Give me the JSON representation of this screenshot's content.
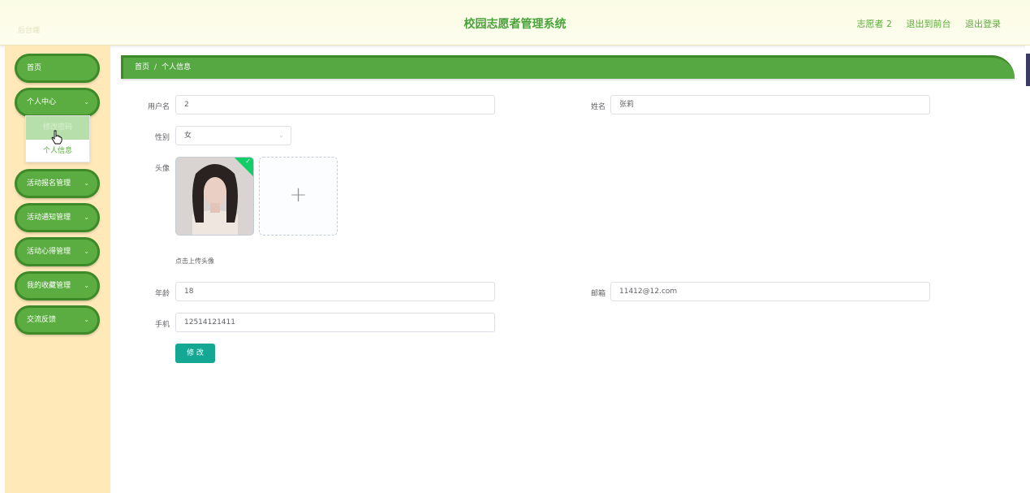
{
  "header": {
    "faint_text": "后台端",
    "title": "校园志愿者管理系统",
    "user": "志愿者 2",
    "to_front": "退出到前台",
    "logout": "退出登录"
  },
  "sidebar": {
    "items": [
      {
        "label": "首页"
      },
      {
        "label": "个人中心"
      },
      {
        "label": "活动报名管理"
      },
      {
        "label": "活动通知管理"
      },
      {
        "label": "活动心得管理"
      },
      {
        "label": "我的收藏管理"
      },
      {
        "label": "交流反馈"
      }
    ],
    "submenu": [
      {
        "label": "修改密码"
      },
      {
        "label": "个人信息"
      }
    ]
  },
  "breadcrumb": {
    "home": "首页",
    "separator": "/",
    "current": "个人信息"
  },
  "form": {
    "username_label": "用户名",
    "username_value": "2",
    "name_label": "姓名",
    "name_value": "张莉",
    "gender_label": "性别",
    "gender_value": "女",
    "avatar_label": "头像",
    "avatar_hint": "点击上传头像",
    "age_label": "年龄",
    "age_value": "18",
    "email_label": "邮箱",
    "email_value": "11412@12.com",
    "phone_label": "手机",
    "phone_value": "12514121411",
    "submit_label": "修 改"
  },
  "icons": {
    "chevron": "chevron-down-icon",
    "upload": "plus-icon",
    "success": "check-icon"
  },
  "colors": {
    "accent_green": "#5cad41",
    "sidebar_bg": "#ffe9b9",
    "submit_teal": "#14a894"
  }
}
